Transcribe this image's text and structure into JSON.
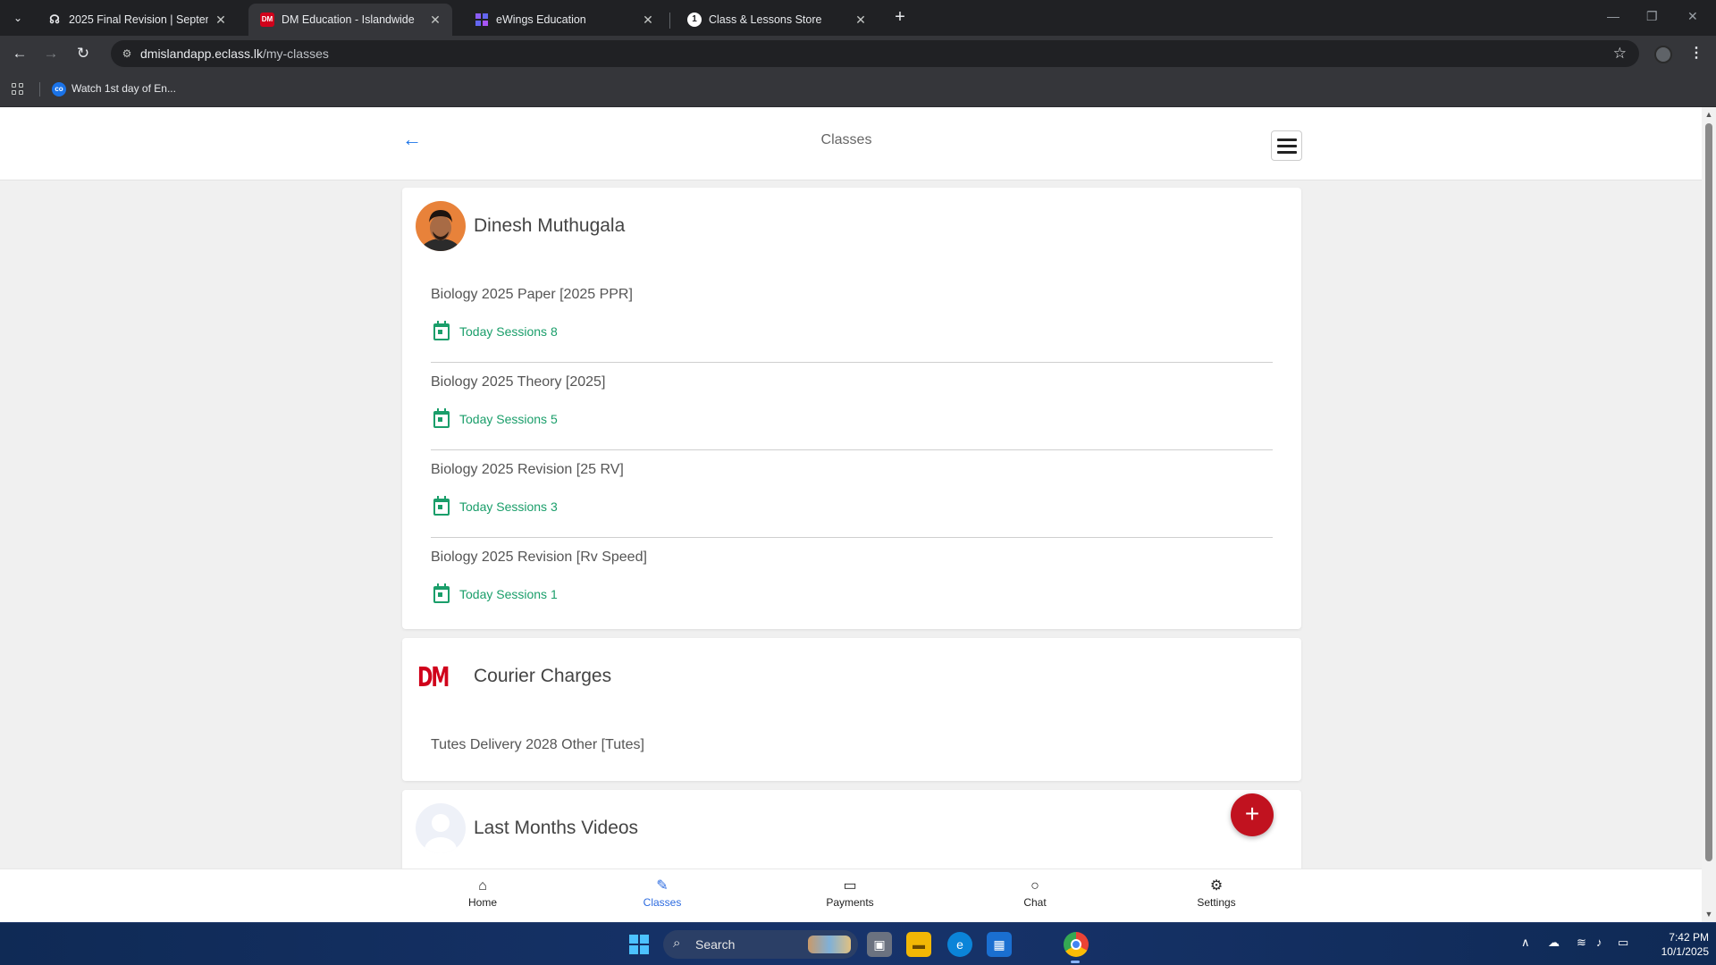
{
  "browser": {
    "tabs": [
      {
        "title": "2025 Final Revision | Septembe",
        "favicon": "headphones-icon",
        "active": false
      },
      {
        "title": "DM Education - Islandwide",
        "favicon": "DM",
        "active": true
      },
      {
        "title": "eWings Education",
        "favicon": "grid-icon",
        "active": false
      },
      {
        "title": "Class & Lessons Store",
        "favicon": "store-icon",
        "active": false
      }
    ],
    "url_host": "dmislandapp.eclass.lk",
    "url_path": "/my-classes",
    "bookmark": "Watch 1st day of En...",
    "bookmark_favicon": "co"
  },
  "page": {
    "title": "Classes"
  },
  "teacher_card": {
    "name": "Dinesh Muthugala",
    "classes": [
      {
        "name": "Biology 2025 Paper [2025 PPR]",
        "sessions": "Today Sessions 8"
      },
      {
        "name": "Biology 2025 Theory [2025]",
        "sessions": "Today Sessions 5"
      },
      {
        "name": "Biology 2025 Revision [25 RV]",
        "sessions": "Today Sessions 3"
      },
      {
        "name": "Biology 2025 Revision [Rv Speed]",
        "sessions": "Today Sessions 1"
      }
    ]
  },
  "courier_card": {
    "logo": "DM",
    "name": "Courier Charges",
    "item": "Tutes Delivery 2028 Other [Tutes]"
  },
  "videos_card": {
    "name": "Last Months Videos"
  },
  "fab_label": "+",
  "bottom_nav": [
    {
      "label": "Home",
      "icon": "home-icon"
    },
    {
      "label": "Classes",
      "icon": "classes-icon",
      "active": true
    },
    {
      "label": "Payments",
      "icon": "wallet-icon"
    },
    {
      "label": "Chat",
      "icon": "chat-icon"
    },
    {
      "label": "Settings",
      "icon": "gear-icon"
    }
  ],
  "taskbar": {
    "search": "Search",
    "time": "7:42 PM",
    "date": "10/1/2025"
  },
  "colors": {
    "accent": "#2c6be0",
    "sessions_green": "#1a9e6a",
    "fab_red": "#c1121f"
  }
}
